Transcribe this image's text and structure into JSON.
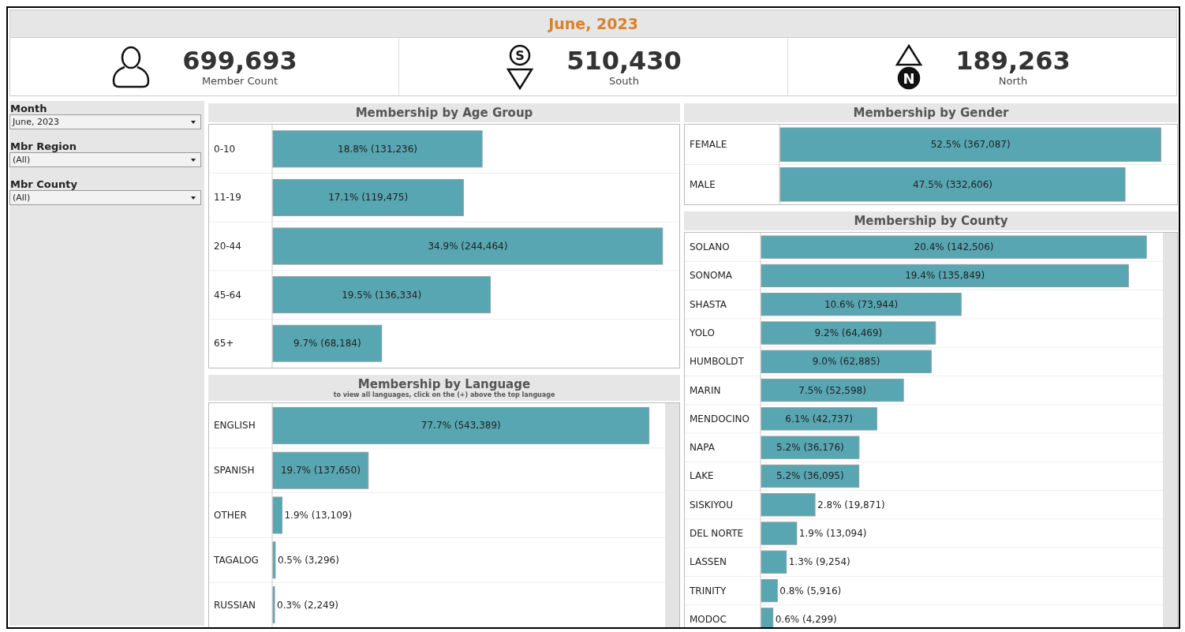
{
  "title": "June, 2023",
  "kpis": [
    {
      "kind": "person",
      "value": "699,693",
      "label": "Member Count"
    },
    {
      "kind": "south",
      "badge": "S",
      "value": "510,430",
      "label": "South"
    },
    {
      "kind": "north",
      "badge": "N",
      "value": "189,263",
      "label": "North"
    }
  ],
  "filters": [
    {
      "label": "Month",
      "value": "June, 2023"
    },
    {
      "label": "Mbr Region",
      "value": "(All)"
    },
    {
      "label": "Mbr County",
      "value": "(All)"
    }
  ],
  "panels": [
    {
      "title": "Membership by Age Group",
      "chart_data": {
        "type": "bar",
        "orientation": "horizontal",
        "categories": [
          "0-10",
          "11-19",
          "20-44",
          "45-64",
          "65+"
        ],
        "values": [
          131236,
          119475,
          244464,
          136334,
          68184
        ],
        "value_labels": [
          "18.8% (131,236)",
          "17.1% (119,475)",
          "34.9% (244,464)",
          "19.5% (136,334)",
          "9.7% (68,184)"
        ]
      }
    },
    {
      "title": "Membership by Language",
      "subtitle": "to view all languages, click on the (+) above the top language",
      "chart_data": {
        "type": "bar",
        "orientation": "horizontal",
        "categories": [
          "ENGLISH",
          "SPANISH",
          "OTHER",
          "TAGALOG",
          "RUSSIAN"
        ],
        "values": [
          543389,
          137650,
          13109,
          3296,
          2249
        ],
        "value_labels": [
          "77.7% (543,389)",
          "19.7% (137,650)",
          "1.9% (13,109)",
          "0.5% (3,296)",
          "0.3% (2,249)"
        ]
      }
    },
    {
      "title": "Membership by Gender",
      "chart_data": {
        "type": "bar",
        "orientation": "horizontal",
        "categories": [
          "FEMALE",
          "MALE"
        ],
        "values": [
          367087,
          332606
        ],
        "value_labels": [
          "52.5% (367,087)",
          "47.5% (332,606)"
        ]
      }
    },
    {
      "title": "Membership by County",
      "chart_data": {
        "type": "bar",
        "orientation": "horizontal",
        "categories": [
          "SOLANO",
          "SONOMA",
          "SHASTA",
          "YOLO",
          "HUMBOLDT",
          "MARIN",
          "MENDOCINO",
          "NAPA",
          "LAKE",
          "SISKIYOU",
          "DEL NORTE",
          "LASSEN",
          "TRINITY",
          "MODOC"
        ],
        "values": [
          142506,
          135849,
          73944,
          64469,
          62885,
          52598,
          42737,
          36176,
          36095,
          19871,
          13094,
          9254,
          5916,
          4299
        ],
        "value_labels": [
          "20.4% (142,506)",
          "19.4% (135,849)",
          "10.6% (73,944)",
          "9.2% (64,469)",
          "9.0% (62,885)",
          "7.5% (52,598)",
          "6.1% (42,737)",
          "5.2% (36,176)",
          "5.2% (36,095)",
          "2.8% (19,871)",
          "1.9% (13,094)",
          "1.3% (9,254)",
          "0.8% (5,916)",
          "0.6% (4,299)"
        ]
      }
    }
  ]
}
